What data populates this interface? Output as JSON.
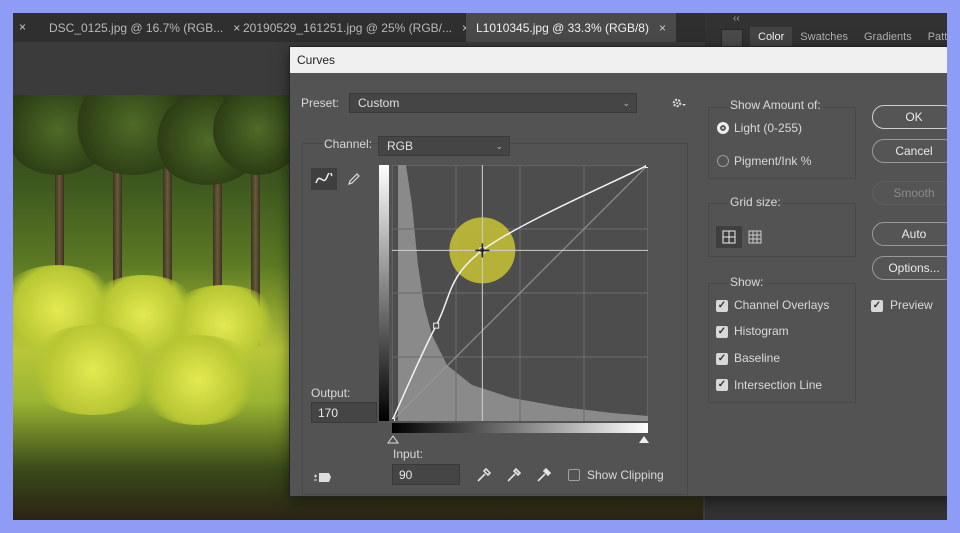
{
  "tabs": [
    {
      "label": "DSC_0125.jpg @ 16.7% (RGB...",
      "close": "×"
    },
    {
      "label": "20190529_161251.jpg @ 25% (RGB/...",
      "close": "×"
    },
    {
      "label": "L1010345.jpg @ 33.3% (RGB/8)",
      "close": "×"
    }
  ],
  "lead_close": "×",
  "right_panel": {
    "collapse": "‹‹",
    "tabs": [
      "Color",
      "Swatches",
      "Gradients",
      "Patte"
    ]
  },
  "dialog": {
    "title": "Curves",
    "close": "×",
    "preset_label": "Preset:",
    "preset_value": "Custom",
    "channel_label": "Channel:",
    "channel_value": "RGB",
    "output_label": "Output:",
    "output_value": "170",
    "input_label": "Input:",
    "input_value": "90",
    "show_clipping": "Show Clipping",
    "show_amount_title": "Show Amount of:",
    "light_label": "Light  (0-255)",
    "pigment_label": "Pigment/Ink %",
    "grid_size_title": "Grid size:",
    "show_title": "Show:",
    "show_options": [
      {
        "label": "Channel Overlays",
        "checked": true
      },
      {
        "label": "Histogram",
        "checked": true
      },
      {
        "label": "Baseline",
        "checked": true
      },
      {
        "label": "Intersection Line",
        "checked": true
      }
    ],
    "buttons": {
      "ok": "OK",
      "cancel": "Cancel",
      "smooth": "Smooth",
      "auto": "Auto",
      "options": "Options..."
    },
    "preview_label": "Preview"
  },
  "curve": {
    "points": [
      [
        0,
        0
      ],
      [
        44,
        95
      ],
      [
        90,
        170
      ],
      [
        255,
        255
      ]
    ],
    "selected_point": [
      90,
      170
    ],
    "range": [
      0,
      255
    ]
  },
  "colors": {
    "highlight": "#c9c434",
    "dialog_bg": "#535353",
    "accent_frame": "#8f9cf5"
  },
  "icons": [
    "curve-tool-icon",
    "pencil-icon",
    "gear-icon",
    "hand-target-icon",
    "black-eyedropper-icon",
    "gray-eyedropper-icon",
    "white-eyedropper-icon"
  ]
}
